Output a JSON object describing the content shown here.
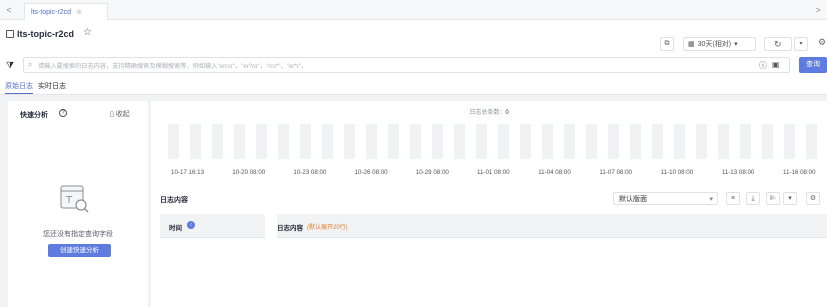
{
  "tab": {
    "label": "lts-topic-r2cd",
    "close": "⊗"
  },
  "nav": {
    "prev": "<",
    "next": ">"
  },
  "header": {
    "title": "lts-topic-r2cd",
    "time_range": "30天(相对)"
  },
  "search": {
    "placeholder": "请输入要搜索的日志内容，支持精确搜索及模糊搜索等，例如输入\"error\"，\"er?or\"，\"rro*\"，\"er*r\"。",
    "button": "查询"
  },
  "subtabs": {
    "raw": "原始日志",
    "realtime": "实时日志"
  },
  "quick_analysis": {
    "title": "快速分析",
    "collapse": "收起",
    "empty_text": "您还没有指定查询字段",
    "create_button": "创建快速分析"
  },
  "histogram": {
    "total_label": "日志总条数：",
    "total_value": "0",
    "ticks": [
      "10-17 16:13",
      "10-20 08:00",
      "10-23 08:00",
      "10-26 08:00",
      "10-29 08:00",
      "11-01 08:00",
      "11-04 08:00",
      "11-07 08:00",
      "11-10 08:00",
      "11-13 08:00",
      "11-16 08:00"
    ]
  },
  "log_content": {
    "title": "日志内容",
    "layout": "默认版面",
    "col_time": "时间",
    "col_content": "日志内容",
    "col_hint": "(默认展开20行)"
  }
}
